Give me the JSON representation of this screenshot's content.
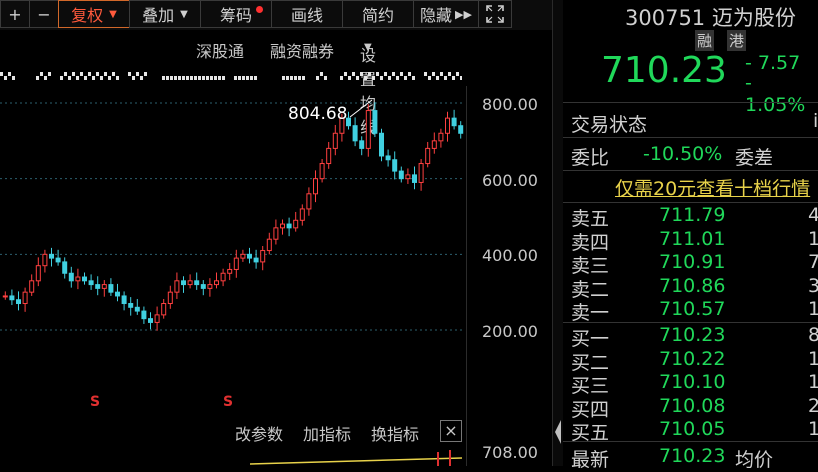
{
  "toolbar": {
    "plus": "+",
    "minus": "−",
    "fuquan": "复权",
    "diejia": "叠加",
    "chouma": "筹码",
    "huaxian": "画线",
    "jianyue": "简约",
    "yincang": "隐藏",
    "expand_icon": "expand-icon",
    "colors": {
      "active": "#ff5a3c",
      "text": "#d0d0d0"
    }
  },
  "chart_header": {
    "shengutong": "深股通",
    "rongzi": "融资融券",
    "set_ma": "设置均线"
  },
  "chart": {
    "high_label": "804.68",
    "y_axis": [
      "800.00",
      "600.00",
      "400.00",
      "200.00"
    ],
    "sub_y_label": "708.00",
    "markers": [
      "S",
      "S"
    ]
  },
  "chart_data": {
    "type": "candlestick",
    "y_ticks": [
      200,
      400,
      600,
      800
    ],
    "ylim": [
      140,
      880
    ],
    "annotation": "804.68",
    "closes": [
      290,
      280,
      270,
      300,
      330,
      370,
      400,
      390,
      380,
      350,
      330,
      340,
      330,
      320,
      310,
      320,
      300,
      290,
      270,
      260,
      250,
      230,
      220,
      240,
      270,
      300,
      330,
      320,
      330,
      320,
      310,
      320,
      330,
      350,
      360,
      390,
      400,
      390,
      380,
      410,
      440,
      470,
      480,
      470,
      490,
      520,
      560,
      600,
      640,
      680,
      720,
      760,
      740,
      700,
      680,
      780,
      720,
      660,
      650,
      620,
      600,
      610,
      590,
      640,
      680,
      700,
      720,
      760,
      740,
      720
    ]
  },
  "bottom_bar": {
    "gaicanshu": "改参数",
    "jiazhibiao": "加指标",
    "huanzhibiao": "换指标",
    "close": "×"
  },
  "quote": {
    "code": "300751",
    "name": "迈为股份",
    "tag_rong": "融",
    "tag_gang": "港",
    "price": "710.23",
    "change": "- 7.57",
    "change_pct": "- 1.05%",
    "status_label": "交易状态",
    "status_value": "i",
    "weibi_label": "委比",
    "weibi_value": "-10.50%",
    "weicha_label": "委差",
    "promo": "仅需20元查看十档行情",
    "asks": [
      {
        "label": "卖五",
        "price": "711.79",
        "vol": "4"
      },
      {
        "label": "卖四",
        "price": "711.01",
        "vol": "1"
      },
      {
        "label": "卖三",
        "price": "710.91",
        "vol": "7"
      },
      {
        "label": "卖二",
        "price": "710.86",
        "vol": "3"
      },
      {
        "label": "卖一",
        "price": "710.57",
        "vol": "1"
      }
    ],
    "bids": [
      {
        "label": "买一",
        "price": "710.23",
        "vol": "8"
      },
      {
        "label": "买二",
        "price": "710.22",
        "vol": "1"
      },
      {
        "label": "买三",
        "price": "710.10",
        "vol": "1"
      },
      {
        "label": "买四",
        "price": "710.08",
        "vol": "2"
      },
      {
        "label": "买五",
        "price": "710.05",
        "vol": "1"
      }
    ],
    "latest_label": "最新",
    "latest_value": "710.23",
    "avg_label": "均价",
    "colors": {
      "green": "#20d85a",
      "text": "#d0d0d0"
    }
  }
}
